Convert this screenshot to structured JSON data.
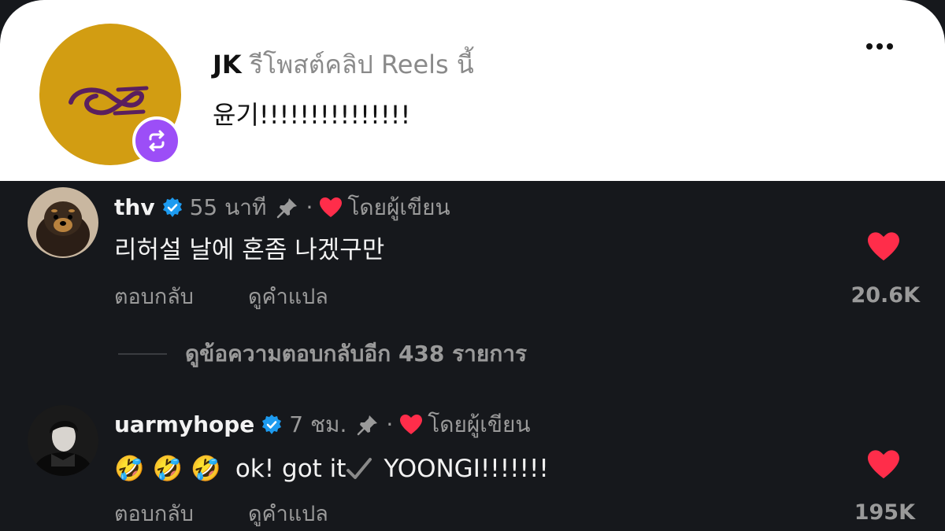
{
  "repost": {
    "username": "JK",
    "action_text": "รีโพสต์คลิป Reels นี้",
    "caption": "윤기!!!!!!!!!!!!!!!",
    "avatar_icon": "repost-logo",
    "badge_icon": "repost-icon"
  },
  "comments": [
    {
      "username": "thv",
      "time": "55 นาที",
      "separator": "·",
      "liked_by_author": "โดยผู้เขียน",
      "text": "리허설 날에 혼좀 나겠구만",
      "reply_label": "ตอบกลับ",
      "translate_label": "ดูคำแปล",
      "likes": "20.6K",
      "view_replies": "ดูข้อความตอบกลับอีก 438 รายการ"
    },
    {
      "username": "uarmyhope",
      "time": "7 ชม.",
      "separator": "·",
      "liked_by_author": "โดยผู้เขียน",
      "emojis": [
        "🤣",
        "🤣",
        "🤣"
      ],
      "text": "ok! got it",
      "text_after": "YOONGI!!!!!!!",
      "reply_label": "ตอบกลับ",
      "translate_label": "ดูคำแปล",
      "likes": "195K"
    }
  ],
  "colors": {
    "background": "#16181c",
    "heart": "#ff2d4a",
    "verified": "#1d9bf0",
    "repost_badge": "#9c4ef7",
    "avatar_gold": "#d29d12"
  }
}
